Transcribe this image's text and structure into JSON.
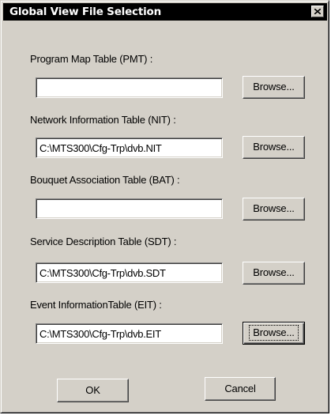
{
  "window": {
    "title": "Global View File Selection",
    "close_icon": "close-x-icon"
  },
  "fields": [
    {
      "label": "Program Map Table (PMT) :",
      "value": "",
      "browse_label": "Browse..."
    },
    {
      "label": "Network Information Table (NIT) :",
      "value": "C:\\MTS300\\Cfg-Trp\\dvb.NIT",
      "browse_label": "Browse..."
    },
    {
      "label": "Bouquet Association Table (BAT) :",
      "value": "",
      "browse_label": "Browse..."
    },
    {
      "label": "Service Description Table (SDT) :",
      "value": "C:\\MTS300\\Cfg-Trp\\dvb.SDT",
      "browse_label": "Browse..."
    },
    {
      "label": "Event InformationTable (EIT) :",
      "value": "C:\\MTS300\\Cfg-Trp\\dvb.EIT",
      "browse_label": "Browse..."
    }
  ],
  "buttons": {
    "ok_label": "OK",
    "cancel_label": "Cancel"
  },
  "colors": {
    "dialog_face": "#d4d0c8",
    "title_bar": "#000000",
    "title_text": "#ffffff"
  }
}
